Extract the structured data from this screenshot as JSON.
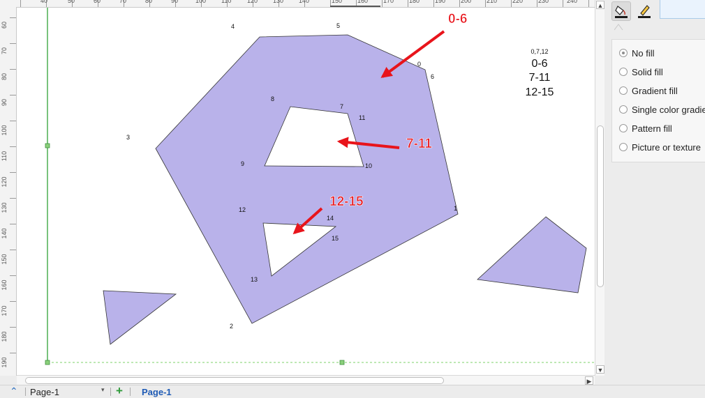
{
  "ruler": {
    "top_ticks": [
      "40",
      "50",
      "60",
      "70",
      "80",
      "90",
      "100",
      "110",
      "120",
      "130",
      "140",
      "150",
      "160",
      "170",
      "180",
      "190",
      "200",
      "210",
      "220",
      "230",
      "240"
    ],
    "left_ticks": [
      "60",
      "70",
      "80",
      "90",
      "100",
      "110",
      "120",
      "130",
      "140",
      "150",
      "160",
      "170",
      "180",
      "190"
    ]
  },
  "canvas": {
    "point_labels": [
      "0",
      "1",
      "2",
      "3",
      "4",
      "5",
      "6",
      "7",
      "8",
      "9",
      "10",
      "11",
      "12",
      "13",
      "14",
      "15"
    ],
    "legend_small": "0,7,12",
    "legend_lines": [
      "0-6",
      "7-11",
      "12-15"
    ],
    "annotations": [
      "0-6",
      "7-11",
      "12-15"
    ],
    "shape_fill": "#b9b2ea",
    "annotation_color": "#e8141b"
  },
  "sidebar": {
    "tools": [
      "fill-bucket-icon",
      "line-pen-icon"
    ],
    "fill_options": [
      {
        "label": "No fill",
        "selected": true
      },
      {
        "label": "Solid fill",
        "selected": false
      },
      {
        "label": "Gradient fill",
        "selected": false
      },
      {
        "label": "Single color gradient",
        "selected": false
      },
      {
        "label": "Pattern fill",
        "selected": false
      },
      {
        "label": "Picture or texture",
        "selected": false
      }
    ]
  },
  "tabs": {
    "page_selector": "Page-1",
    "active_tab": "Page-1"
  }
}
